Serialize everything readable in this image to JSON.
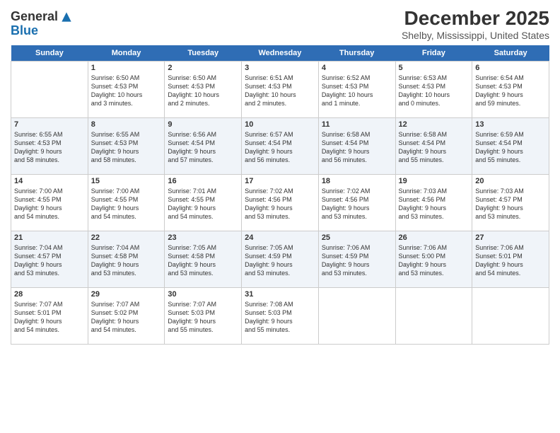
{
  "header": {
    "logo_line1": "General",
    "logo_line2": "Blue",
    "month_title": "December 2025",
    "location": "Shelby, Mississippi, United States"
  },
  "days_of_week": [
    "Sunday",
    "Monday",
    "Tuesday",
    "Wednesday",
    "Thursday",
    "Friday",
    "Saturday"
  ],
  "weeks": [
    [
      {
        "num": "",
        "info": ""
      },
      {
        "num": "1",
        "info": "Sunrise: 6:50 AM\nSunset: 4:53 PM\nDaylight: 10 hours\nand 3 minutes."
      },
      {
        "num": "2",
        "info": "Sunrise: 6:50 AM\nSunset: 4:53 PM\nDaylight: 10 hours\nand 2 minutes."
      },
      {
        "num": "3",
        "info": "Sunrise: 6:51 AM\nSunset: 4:53 PM\nDaylight: 10 hours\nand 2 minutes."
      },
      {
        "num": "4",
        "info": "Sunrise: 6:52 AM\nSunset: 4:53 PM\nDaylight: 10 hours\nand 1 minute."
      },
      {
        "num": "5",
        "info": "Sunrise: 6:53 AM\nSunset: 4:53 PM\nDaylight: 10 hours\nand 0 minutes."
      },
      {
        "num": "6",
        "info": "Sunrise: 6:54 AM\nSunset: 4:53 PM\nDaylight: 9 hours\nand 59 minutes."
      }
    ],
    [
      {
        "num": "7",
        "info": "Sunrise: 6:55 AM\nSunset: 4:53 PM\nDaylight: 9 hours\nand 58 minutes."
      },
      {
        "num": "8",
        "info": "Sunrise: 6:55 AM\nSunset: 4:53 PM\nDaylight: 9 hours\nand 58 minutes."
      },
      {
        "num": "9",
        "info": "Sunrise: 6:56 AM\nSunset: 4:54 PM\nDaylight: 9 hours\nand 57 minutes."
      },
      {
        "num": "10",
        "info": "Sunrise: 6:57 AM\nSunset: 4:54 PM\nDaylight: 9 hours\nand 56 minutes."
      },
      {
        "num": "11",
        "info": "Sunrise: 6:58 AM\nSunset: 4:54 PM\nDaylight: 9 hours\nand 56 minutes."
      },
      {
        "num": "12",
        "info": "Sunrise: 6:58 AM\nSunset: 4:54 PM\nDaylight: 9 hours\nand 55 minutes."
      },
      {
        "num": "13",
        "info": "Sunrise: 6:59 AM\nSunset: 4:54 PM\nDaylight: 9 hours\nand 55 minutes."
      }
    ],
    [
      {
        "num": "14",
        "info": "Sunrise: 7:00 AM\nSunset: 4:55 PM\nDaylight: 9 hours\nand 54 minutes."
      },
      {
        "num": "15",
        "info": "Sunrise: 7:00 AM\nSunset: 4:55 PM\nDaylight: 9 hours\nand 54 minutes."
      },
      {
        "num": "16",
        "info": "Sunrise: 7:01 AM\nSunset: 4:55 PM\nDaylight: 9 hours\nand 54 minutes."
      },
      {
        "num": "17",
        "info": "Sunrise: 7:02 AM\nSunset: 4:56 PM\nDaylight: 9 hours\nand 53 minutes."
      },
      {
        "num": "18",
        "info": "Sunrise: 7:02 AM\nSunset: 4:56 PM\nDaylight: 9 hours\nand 53 minutes."
      },
      {
        "num": "19",
        "info": "Sunrise: 7:03 AM\nSunset: 4:56 PM\nDaylight: 9 hours\nand 53 minutes."
      },
      {
        "num": "20",
        "info": "Sunrise: 7:03 AM\nSunset: 4:57 PM\nDaylight: 9 hours\nand 53 minutes."
      }
    ],
    [
      {
        "num": "21",
        "info": "Sunrise: 7:04 AM\nSunset: 4:57 PM\nDaylight: 9 hours\nand 53 minutes."
      },
      {
        "num": "22",
        "info": "Sunrise: 7:04 AM\nSunset: 4:58 PM\nDaylight: 9 hours\nand 53 minutes."
      },
      {
        "num": "23",
        "info": "Sunrise: 7:05 AM\nSunset: 4:58 PM\nDaylight: 9 hours\nand 53 minutes."
      },
      {
        "num": "24",
        "info": "Sunrise: 7:05 AM\nSunset: 4:59 PM\nDaylight: 9 hours\nand 53 minutes."
      },
      {
        "num": "25",
        "info": "Sunrise: 7:06 AM\nSunset: 4:59 PM\nDaylight: 9 hours\nand 53 minutes."
      },
      {
        "num": "26",
        "info": "Sunrise: 7:06 AM\nSunset: 5:00 PM\nDaylight: 9 hours\nand 53 minutes."
      },
      {
        "num": "27",
        "info": "Sunrise: 7:06 AM\nSunset: 5:01 PM\nDaylight: 9 hours\nand 54 minutes."
      }
    ],
    [
      {
        "num": "28",
        "info": "Sunrise: 7:07 AM\nSunset: 5:01 PM\nDaylight: 9 hours\nand 54 minutes."
      },
      {
        "num": "29",
        "info": "Sunrise: 7:07 AM\nSunset: 5:02 PM\nDaylight: 9 hours\nand 54 minutes."
      },
      {
        "num": "30",
        "info": "Sunrise: 7:07 AM\nSunset: 5:03 PM\nDaylight: 9 hours\nand 55 minutes."
      },
      {
        "num": "31",
        "info": "Sunrise: 7:08 AM\nSunset: 5:03 PM\nDaylight: 9 hours\nand 55 minutes."
      },
      {
        "num": "",
        "info": ""
      },
      {
        "num": "",
        "info": ""
      },
      {
        "num": "",
        "info": ""
      }
    ]
  ]
}
